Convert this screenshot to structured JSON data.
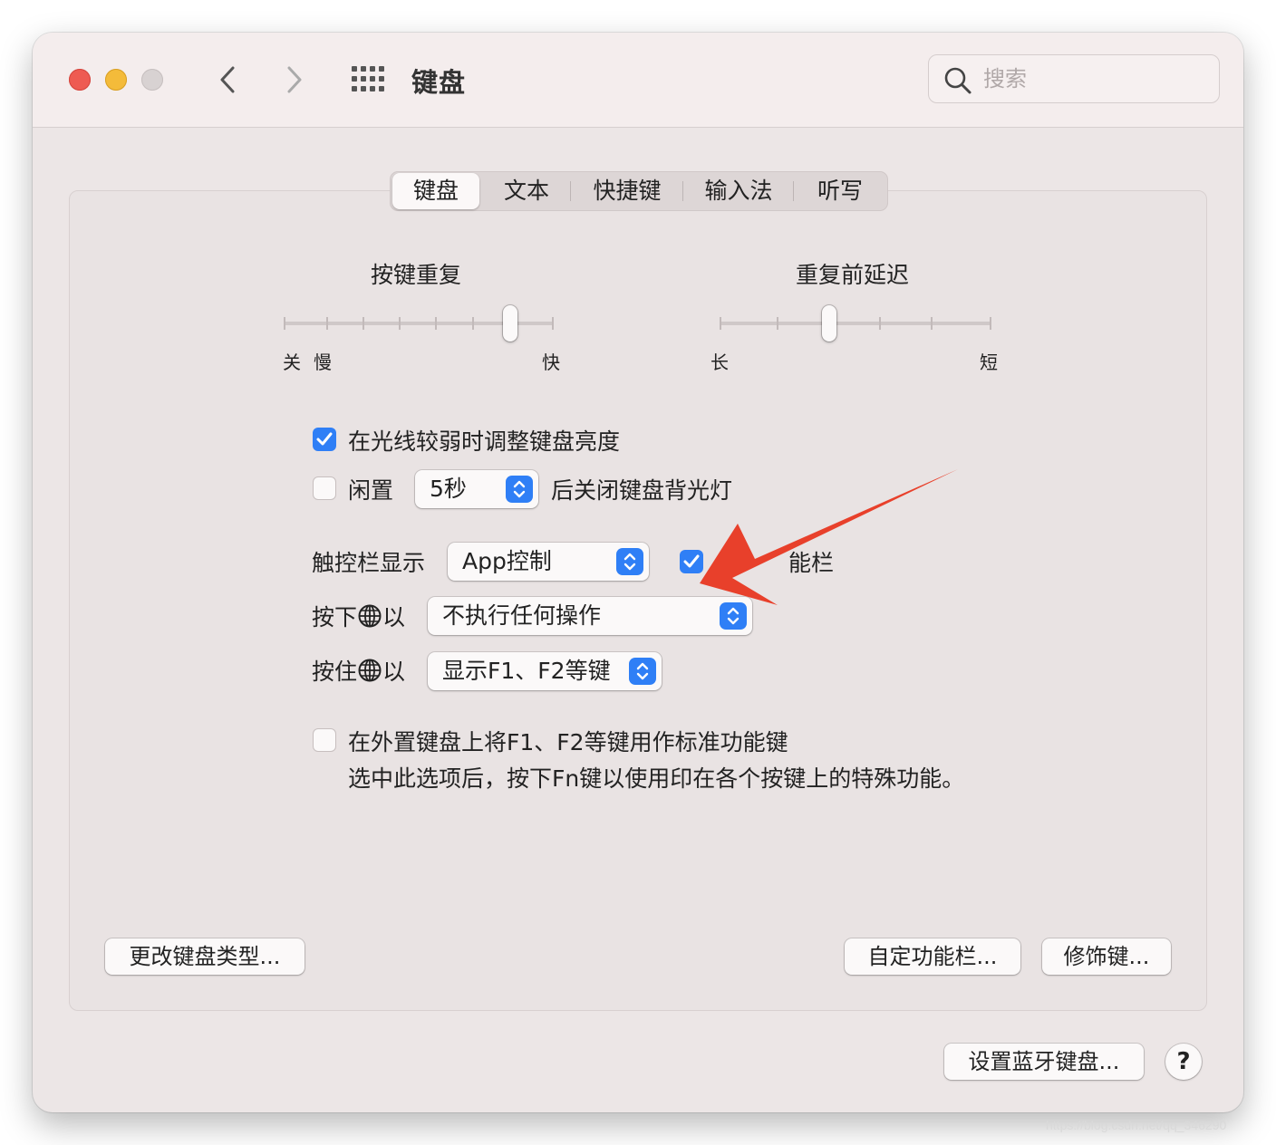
{
  "window": {
    "title": "键盘",
    "search_placeholder": "搜索"
  },
  "tabs": [
    {
      "label": "键盘",
      "active": true
    },
    {
      "label": "文本",
      "active": false
    },
    {
      "label": "快捷键",
      "active": false
    },
    {
      "label": "输入法",
      "active": false
    },
    {
      "label": "听写",
      "active": false
    }
  ],
  "key_repeat": {
    "title": "按键重复",
    "label_off": "关",
    "label_slow": "慢",
    "label_fast": "快",
    "level": 0.75
  },
  "repeat_delay": {
    "title": "重复前延迟",
    "label_long": "长",
    "label_short": "短",
    "level": 0.4
  },
  "options": {
    "adjust_brightness": {
      "label": "在光线较弱时调整键盘亮度",
      "checked": true
    },
    "idle": {
      "label": "闲置",
      "checked": false,
      "value": "5秒",
      "suffix": "后关闭键盘背光灯"
    },
    "touch_bar": {
      "label": "触控栏显示",
      "value": "App控制",
      "checkbox_checked": true,
      "checkbox_label": "能栏"
    },
    "press_globe": {
      "prefix": "按下",
      "suffix": "以",
      "value": "不执行任何操作"
    },
    "hold_globe": {
      "prefix": "按住",
      "suffix": "以",
      "value": "显示F1、F2等键"
    },
    "fn_keys": {
      "label": "在外置键盘上将F1、F2等键用作标准功能键",
      "description": "选中此选项后，按下Fn键以使用印在各个按键上的特殊功能。",
      "checked": false
    }
  },
  "buttons": {
    "change_keyboard_type": "更改键盘类型...",
    "customize_control_strip": "自定功能栏...",
    "modifier_keys": "修饰键...",
    "setup_bluetooth": "设置蓝牙键盘...",
    "help": "?"
  },
  "colors": {
    "accent": "#2f7ff6",
    "arrow": "#e8402b",
    "close": "#ee5b52",
    "minimize": "#f4bb3a"
  },
  "watermark": "https://blog.csdn.net/qq_346290"
}
